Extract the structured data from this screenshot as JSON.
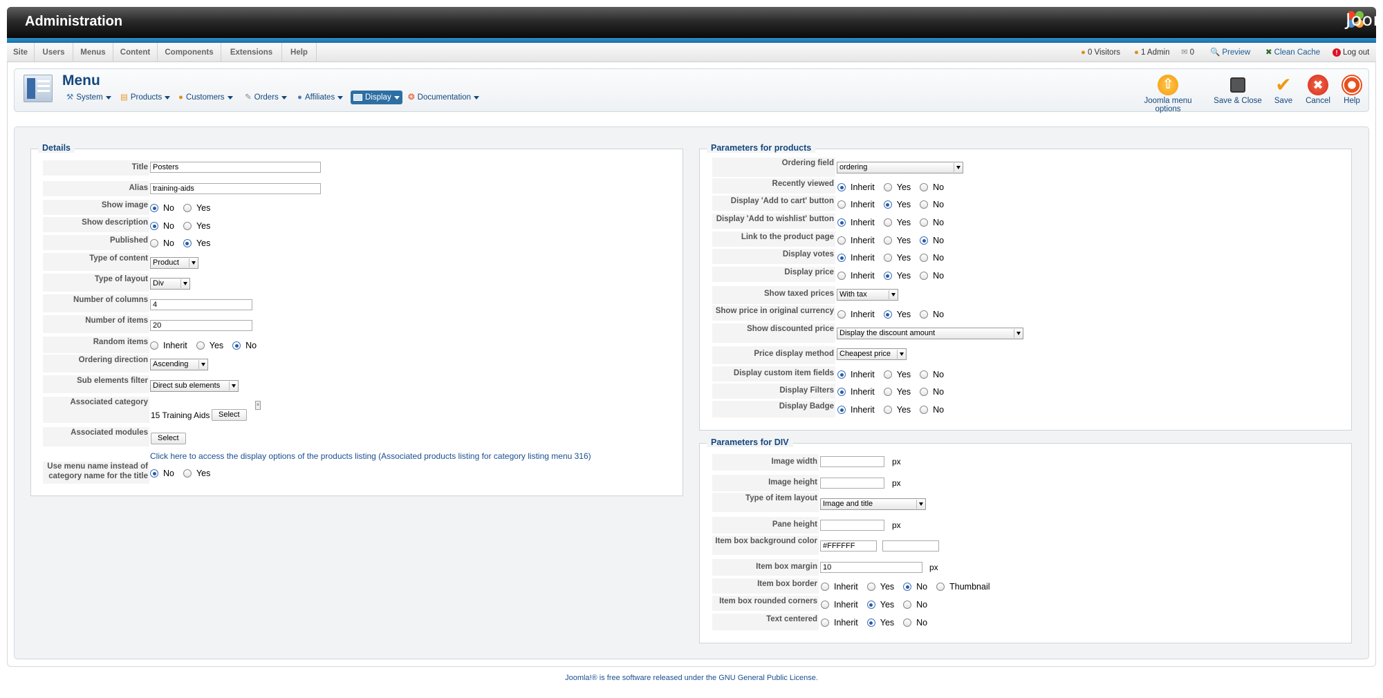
{
  "header": {
    "title": "Administration",
    "brand": "Joomla!"
  },
  "menubar": {
    "items": [
      "Site",
      "Users",
      "Menus",
      "Content",
      "Components",
      "Extensions",
      "Help"
    ]
  },
  "status": {
    "visitors": "0 Visitors",
    "admins": "1 Admin",
    "messages": "0",
    "preview": "Preview",
    "clean_cache": "Clean Cache",
    "logout": "Log out"
  },
  "toolbar": {
    "title": "Menu",
    "submenu": [
      "System",
      "Products",
      "Customers",
      "Orders",
      "Affiliates",
      "Display",
      "Documentation"
    ],
    "active": "Display",
    "buttons": [
      "Joomla menu options",
      "Save & Close",
      "Save",
      "Cancel",
      "Help"
    ]
  },
  "details": {
    "legend": "Details",
    "title_label": "Title",
    "title_value": "Posters",
    "alias_label": "Alias",
    "alias_value": "training-aids",
    "show_image": "Show image",
    "show_description": "Show description",
    "published": "Published",
    "type_of_content": "Type of content",
    "type_of_content_value": "Product",
    "type_of_layout": "Type of layout",
    "type_of_layout_value": "Div",
    "num_columns": "Number of columns",
    "num_columns_value": "4",
    "num_items": "Number of items",
    "num_items_value": "20",
    "random_items": "Random items",
    "ordering_direction": "Ordering direction",
    "ordering_direction_value": "Ascending",
    "sub_filter": "Sub elements filter",
    "sub_filter_value": "Direct sub elements",
    "assoc_category": "Associated category",
    "assoc_category_value": "15 Training Aids",
    "assoc_modules": "Associated modules",
    "select": "Select",
    "link_text": "Click here to access the display options of the products listing (Associated products listing for category listing menu 316)",
    "use_menu_name_1": "Use menu name instead of",
    "use_menu_name_2": "category name for the title"
  },
  "products": {
    "legend": "Parameters for products",
    "ordering_field": "Ordering field",
    "ordering_field_value": "ordering",
    "recently_viewed": "Recently viewed",
    "add_to_cart": "Display 'Add to cart' button",
    "add_to_wishlist": "Display 'Add to wishlist' button",
    "link_product": "Link to the product page",
    "display_votes": "Display votes",
    "display_price": "Display price",
    "taxed_prices": "Show taxed prices",
    "taxed_prices_value": "With tax",
    "orig_currency": "Show price in original currency",
    "discounted_price": "Show discounted price",
    "discounted_price_value": "Display the discount amount",
    "price_method": "Price display method",
    "price_method_value": "Cheapest price",
    "custom_fields": "Display custom item fields",
    "display_filters": "Display Filters",
    "display_badge": "Display Badge"
  },
  "div": {
    "legend": "Parameters for DIV",
    "image_width": "Image width",
    "image_height": "Image height",
    "item_layout": "Type of item layout",
    "item_layout_value": "Image and title",
    "pane_height": "Pane height",
    "bg_color": "Item box background color",
    "bg_color_value": "#FFFFFF",
    "box_margin": "Item box margin",
    "box_margin_value": "10",
    "box_border": "Item box border",
    "rounded": "Item box rounded corners",
    "centered": "Text centered",
    "px": "px"
  },
  "opts": {
    "no": "No",
    "yes": "Yes",
    "inherit": "Inherit",
    "thumbnail": "Thumbnail"
  },
  "footer": {
    "text": "Joomla!® is free software released under the",
    "license": "GNU General Public License."
  }
}
